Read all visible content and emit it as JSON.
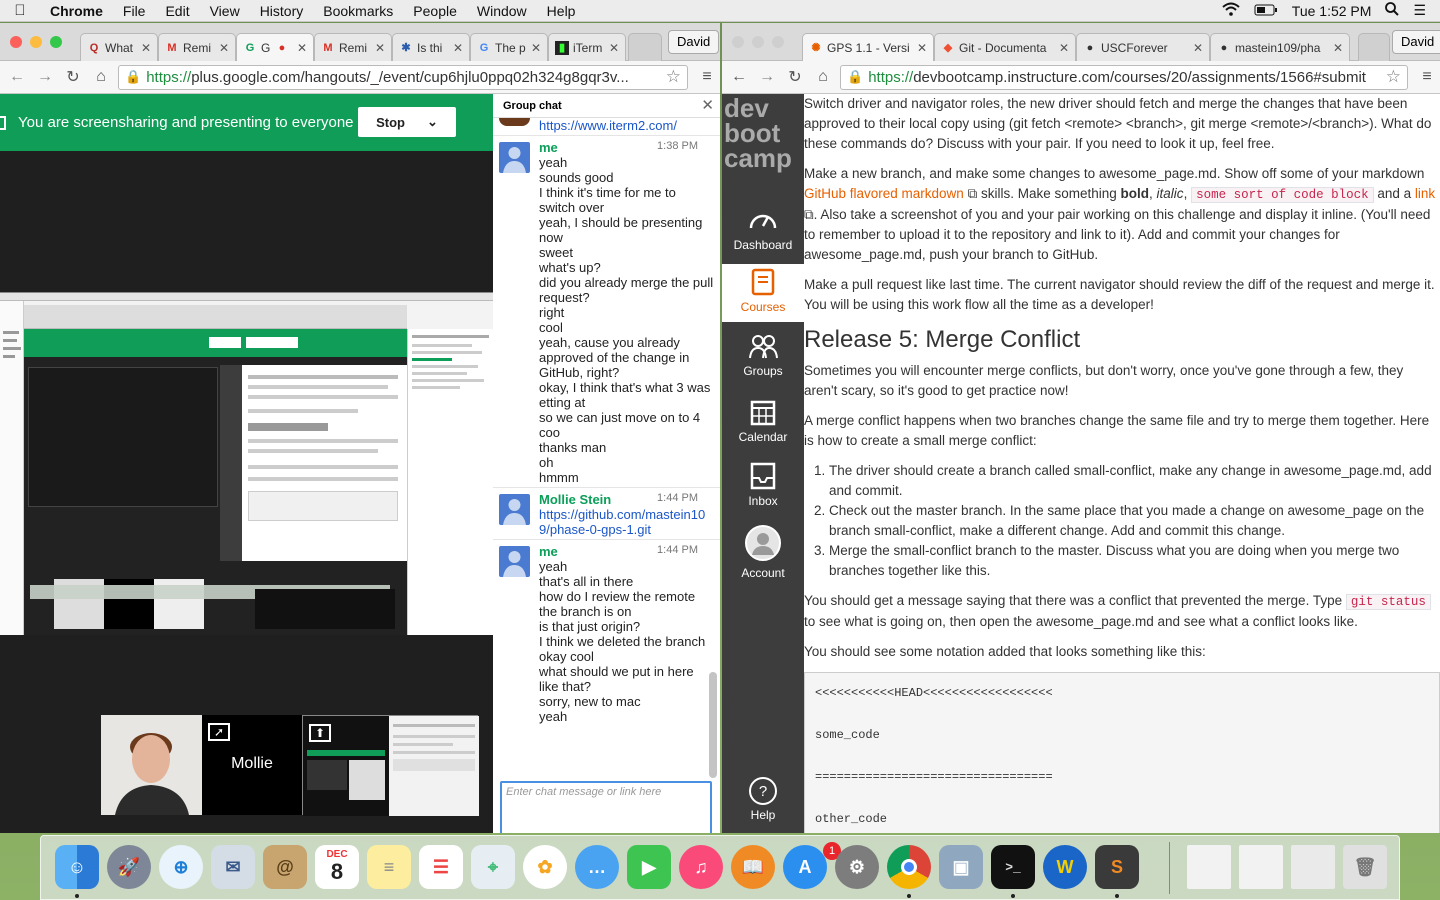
{
  "menubar": {
    "app": "Chrome",
    "items": [
      "File",
      "Edit",
      "View",
      "History",
      "Bookmarks",
      "People",
      "Window",
      "Help"
    ],
    "clock": "Tue 1:52 PM",
    "user": "David"
  },
  "left_browser": {
    "tabs": [
      "What",
      "Remi",
      "G",
      "Remi",
      "Is thi",
      "The p",
      "iTerm"
    ],
    "profile": "David",
    "url_https": "https://",
    "url_rest": "plus.google.com/hangouts/_/event/cup6hjlu0ppq02h324g8gqr3v...",
    "share_text": "You are screensharing and presenting to everyone",
    "stop_label": "Stop",
    "chat": {
      "header": "Group chat",
      "top_link": "https://www.iterm2.com/",
      "messages": [
        {
          "author": "me",
          "time": "1:38 PM",
          "lines": [
            "yeah",
            "sounds good",
            "I think it's time for me to switch over",
            "yeah, I should be presenting now",
            "sweet",
            "what's up?",
            "did you already merge the pull request?",
            "right",
            "cool",
            "yeah, cause you already approved of the change in GitHub, right?",
            "okay, I think that's what 3 was etting at",
            "so we can just move on to 4",
            "coo",
            "thanks man",
            "oh",
            "hmmm"
          ]
        },
        {
          "author": "Mollie Stein",
          "time": "1:44 PM",
          "link": "https://github.com/mastein109/phase-0-gps-1.git"
        },
        {
          "author": "me",
          "time": "1:44 PM",
          "lines": [
            "yeah",
            "that's all in there",
            "how do I review the remote the branch is on",
            "is that just origin?",
            "I think we deleted the branch",
            "okay cool",
            "what should we put in here like that?",
            "sorry, new to mac",
            "yeah"
          ]
        }
      ],
      "input_placeholder": "Enter chat message or link here"
    },
    "video_name": "Mollie"
  },
  "right_browser": {
    "tabs": [
      "GPS 1.1 - Versi",
      "Git - Documenta",
      "USCForever",
      "mastein109/pha"
    ],
    "profile": "David",
    "url_https": "https://",
    "url_rest": "devbootcamp.instructure.com/courses/20/assignments/1566#submit",
    "logo": [
      "dev",
      "boot",
      "camp"
    ],
    "nav": [
      "Dashboard",
      "Courses",
      "Groups",
      "Calendar",
      "Inbox",
      "Account",
      "Help"
    ],
    "content": {
      "p1": "Switch driver and navigator roles, the new driver should fetch and merge the changes that have been approved to their local copy using (git fetch <remote> <branch>, git merge <remote>/<branch>). What do these commands do? Discuss with your pair. If you need to look it up, feel free.",
      "p2a": "Make a new branch, and make some changes to awesome_page.md. Show off some of your markdown ",
      "p2link": "GitHub flavored markdown",
      "p2b": " skills. Make something ",
      "p2bold": "bold",
      "p2c": ", ",
      "p2italic": "italic",
      "p2d": ", ",
      "p2code": "some sort of code block",
      "p2e": " and a ",
      "p2link2": "link",
      "p2f": ". Also take a screenshot of you and your pair working on this challenge and display it inline. (You'll need to remember to upload it to the repository and link to it). Add and commit your changes for awesome_page.md, push your branch to GitHub.",
      "p3": "Make a pull request like last time. The current navigator should review the diff of the request and merge it. You will be using this work flow all the time as a developer!",
      "h2": "Release 5: Merge Conflict",
      "p4": "Sometimes you will encounter merge conflicts, but don't worry, once you've gone through a few, they aren't scary, so it's good to get practice now!",
      "p5": "A merge conflict happens when two branches change the same file and try to merge them together. Here is how to create a small merge conflict:",
      "steps": [
        "The driver should create a branch called small-conflict, make any change in awesome_page.md, add and commit.",
        "Check out the master branch. In the same place that you made a change on awesome_page on the branch small-conflict, make a different change. Add and commit this change.",
        "Merge the small-conflict branch to the master. Discuss what you are doing when you merge two branches together like this."
      ],
      "p6a": "You should get a message saying that there was a conflict that prevented the merge. Type ",
      "p6code": "git status",
      "p6b": " to see what is going on, then open the awesome_page.md and see what a conflict looks like.",
      "p7": "You should see some notation added that looks something like this:",
      "code_lines": [
        "<<<<<<<<<<<HEAD<<<<<<<<<<<<<<<<<<",
        "some_code",
        "=================================",
        "other_code"
      ]
    }
  },
  "dock": {
    "calendar_month": "DEC",
    "calendar_day": "8",
    "appstore_badge": "1"
  },
  "colors": {
    "hangouts_green": "#0f9d58",
    "canvas_orange": "#e66000",
    "canvas_sidebar": "#3d3d3d"
  }
}
